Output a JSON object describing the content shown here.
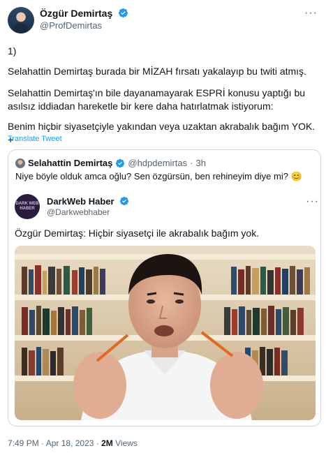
{
  "author": {
    "name": "Özgür Demirtaş",
    "handle": "@ProfDemirtas"
  },
  "tweet": {
    "lines": [
      "1)",
      "Selahattin Demirtaş burada bir MİZAH fırsatı yakalayıp bu twiti atmış.",
      "Selahattin Demirtaş'ın bile dayanamayarak ESPRİ konusu yaptığı bu\nasılsız iddiadan hareketle bir kere daha hatırlatmak istiyorum:",
      "Benim hiçbir siyasetçiyle yakından veya uzaktan akrabalık bağım YOK. +"
    ],
    "translate_label": "Translate Tweet"
  },
  "quote": {
    "name": "Selahattin Demirtaş",
    "handle": "@hdpdemirtas",
    "separator": "·",
    "time": "3h",
    "text": "Niye böyle olduk amca oğlu? Sen özgürsün, ben rehineyim diye mi? 😊",
    "inner": {
      "name": "DarkWeb Haber",
      "handle": "@Darkwebhaber",
      "avatar_text_1": "DARK WEB",
      "avatar_text_2": "HABER",
      "text": "Özgür Demirtaş: Hiçbir siyasetçi ile akrabalık bağım yok."
    }
  },
  "footer": {
    "time": "7:49 PM",
    "sep1": "·",
    "date": "Apr 18, 2023",
    "sep2": "·",
    "views_count": "2M",
    "views_label": "Views"
  },
  "icons": {
    "verified": "verified-badge-icon",
    "more": "more-horizontal-icon"
  },
  "colors": {
    "verified": "#1d9bf0",
    "link": "#1d9bf0",
    "secondary_text": "#536471"
  }
}
